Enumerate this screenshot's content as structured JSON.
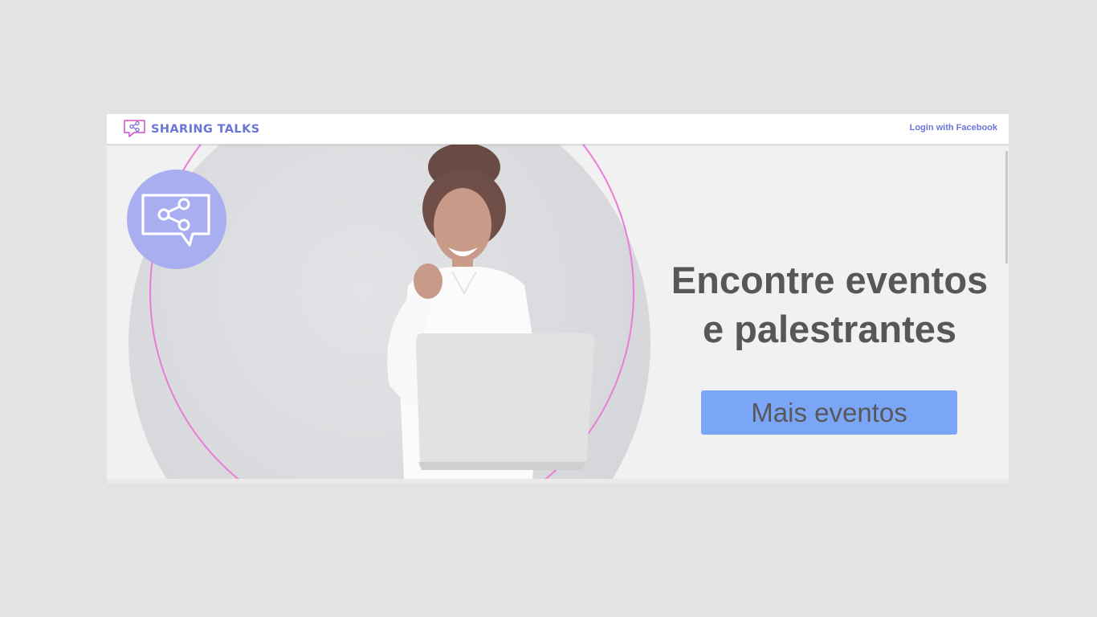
{
  "navbar": {
    "brand_name": "SHARING TALKS",
    "login_link": "Login with Facebook"
  },
  "hero": {
    "headline_line1": "Encontre eventos",
    "headline_line2": "e palestrantes",
    "cta_label": "Mais eventos"
  },
  "icons": {
    "logo": "chat-share-icon",
    "badge": "chat-share-icon"
  },
  "colors": {
    "brand": "#6b74d8",
    "badge_bg": "#a8aef0",
    "cta_bg": "#7ba5f6",
    "ring": "#ec7bd8",
    "headline": "#575757"
  }
}
